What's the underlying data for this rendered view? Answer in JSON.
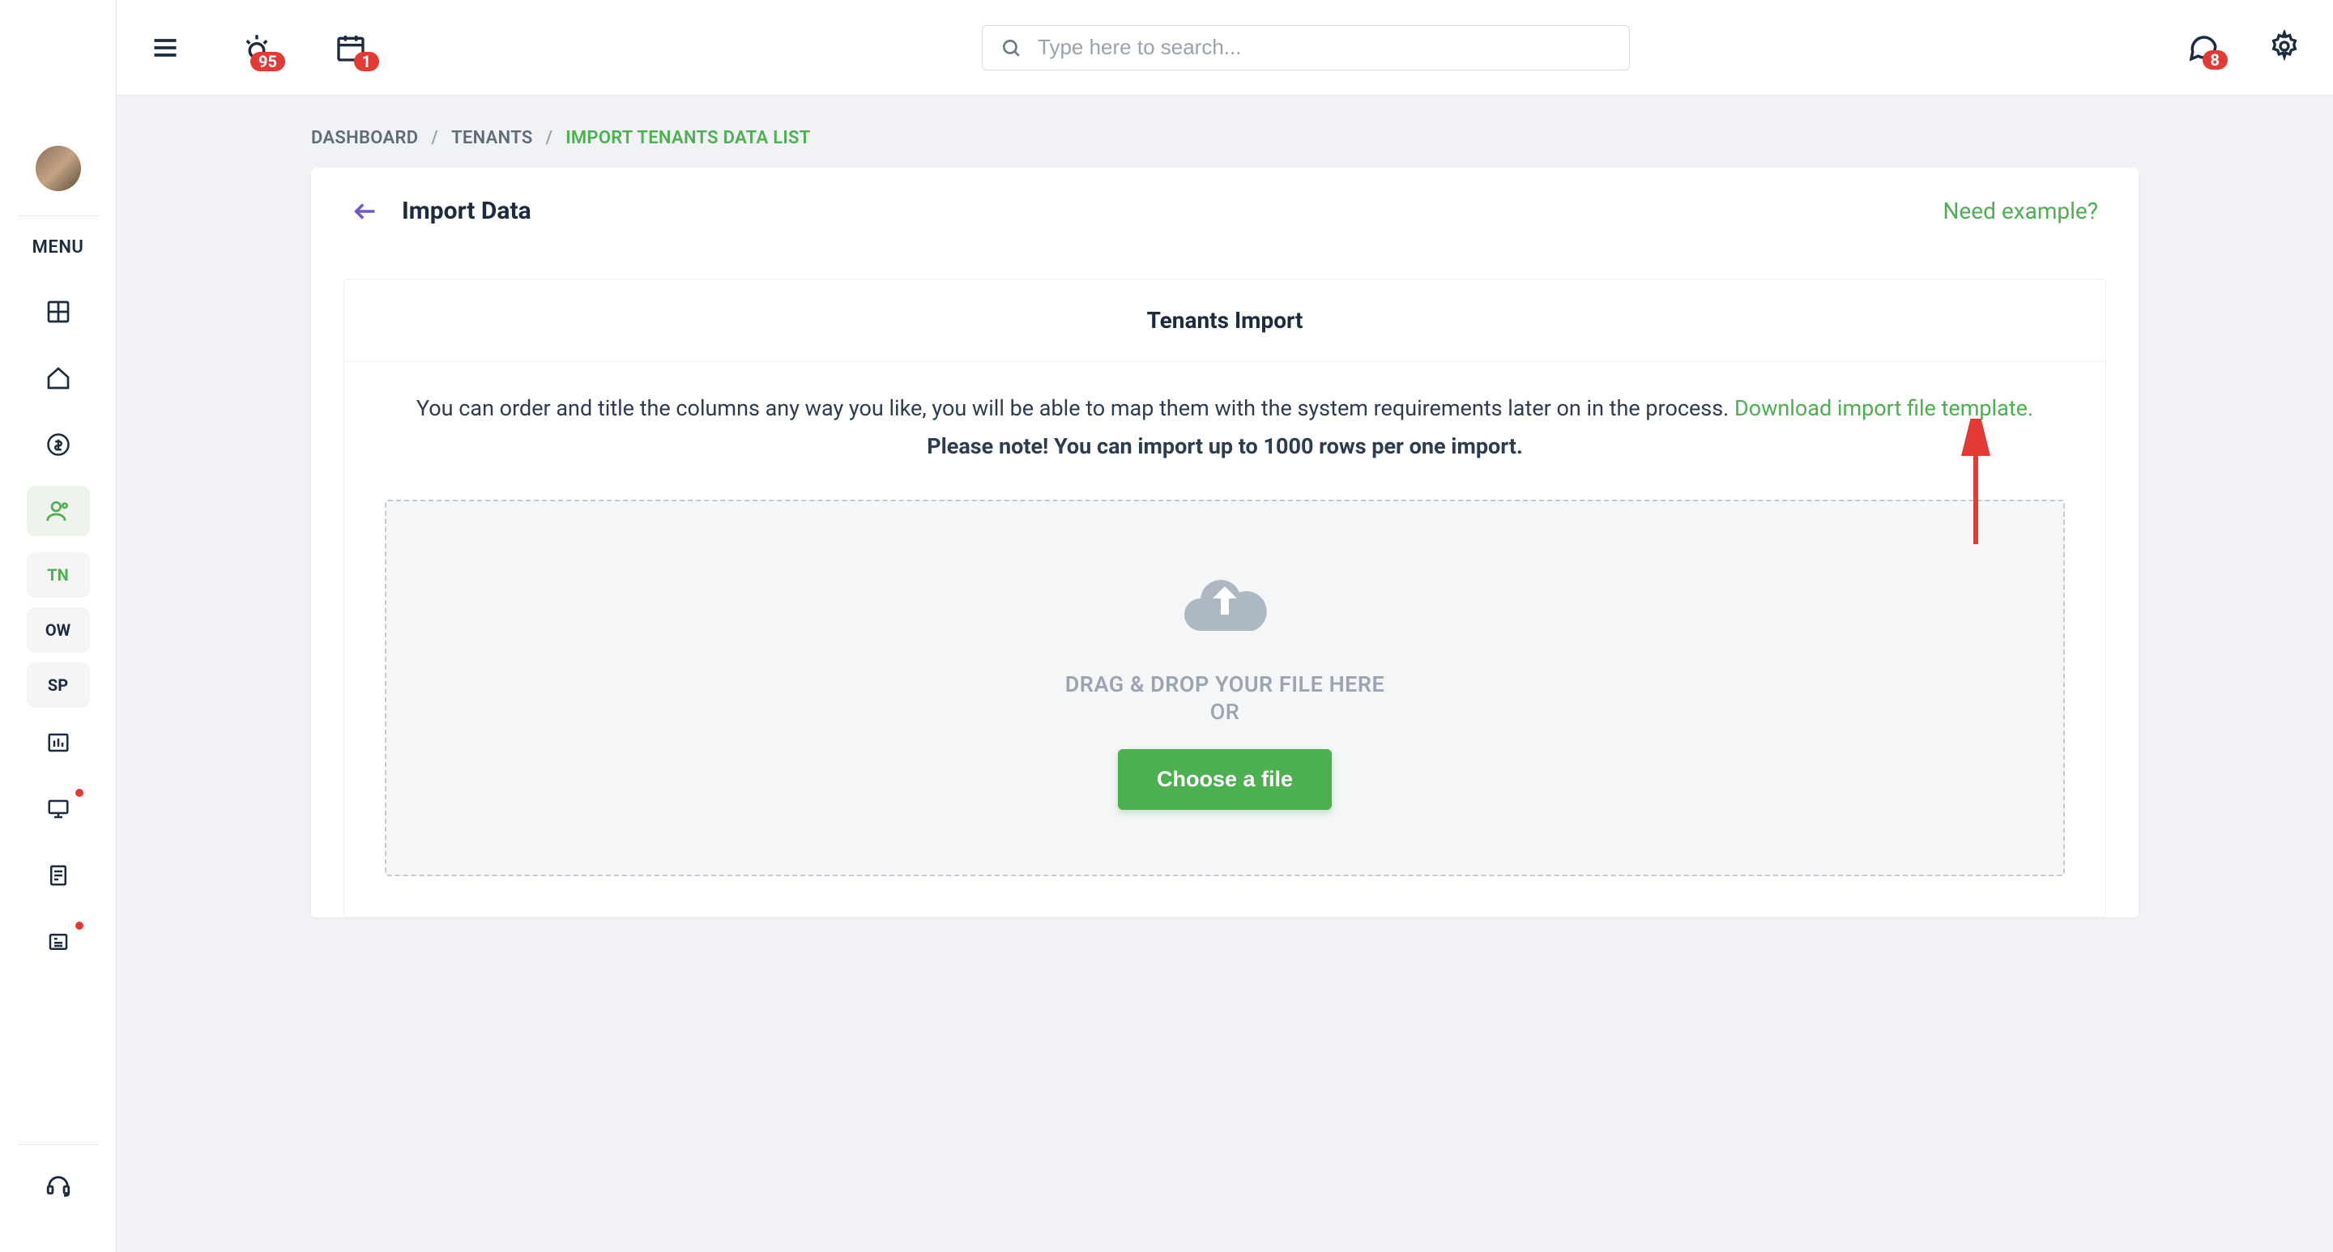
{
  "header": {
    "search_placeholder": "Type here to search...",
    "badges": {
      "sun": "95",
      "calendar": "1",
      "chat": "8"
    }
  },
  "sidebar": {
    "menu_label": "MENU",
    "sub_items": {
      "tn": "TN",
      "ow": "OW",
      "sp": "SP"
    }
  },
  "breadcrumb": {
    "dashboard": "DASHBOARD",
    "tenants": "TENANTS",
    "current": "IMPORT TENANTS DATA LIST"
  },
  "page": {
    "title": "Import Data",
    "example_link": "Need example?"
  },
  "import_card": {
    "heading": "Tenants Import",
    "instruction_text": "You can order and title the columns any way you like, you will be able to map them with the system requirements later on in the process. ",
    "download_link": "Download import file template.",
    "note_text": "Please note! You can import up to 1000 rows per one import.",
    "dropzone": {
      "drag_text": "DRAG & DROP YOUR FILE HERE",
      "or_text": "OR",
      "button_label": "Choose a file"
    }
  }
}
